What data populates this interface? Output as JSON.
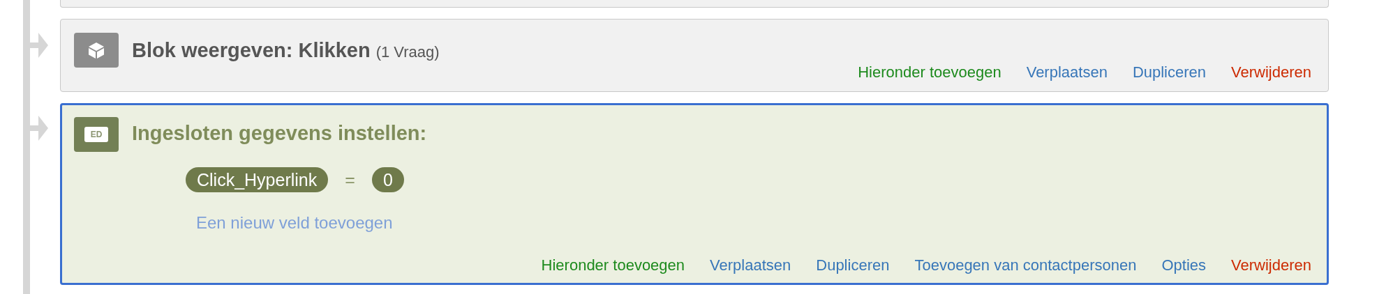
{
  "blocks": [
    {
      "kind": "block",
      "selected": false,
      "title": "Blok weergeven: Klikken",
      "count": "(1 Vraag)",
      "actions": [
        {
          "kind": "add",
          "label": "Hieronder toevoegen"
        },
        {
          "kind": "normal",
          "label": "Verplaatsen"
        },
        {
          "kind": "normal",
          "label": "Dupliceren"
        },
        {
          "kind": "delete",
          "label": "Verwijderen"
        }
      ]
    },
    {
      "kind": "embedded_data",
      "selected": true,
      "icon_label": "ED",
      "title": "Ingesloten gegevens instellen:",
      "fields": [
        {
          "name": "Click_Hyperlink",
          "operator": "=",
          "value": "0"
        }
      ],
      "add_field": "Een nieuw veld toevoegen",
      "actions": [
        {
          "kind": "add",
          "label": "Hieronder toevoegen"
        },
        {
          "kind": "normal",
          "label": "Verplaatsen"
        },
        {
          "kind": "normal",
          "label": "Dupliceren"
        },
        {
          "kind": "normal",
          "label": "Toevoegen van contactpersonen"
        },
        {
          "kind": "normal",
          "label": "Opties"
        },
        {
          "kind": "delete",
          "label": "Verwijderen"
        }
      ]
    }
  ]
}
